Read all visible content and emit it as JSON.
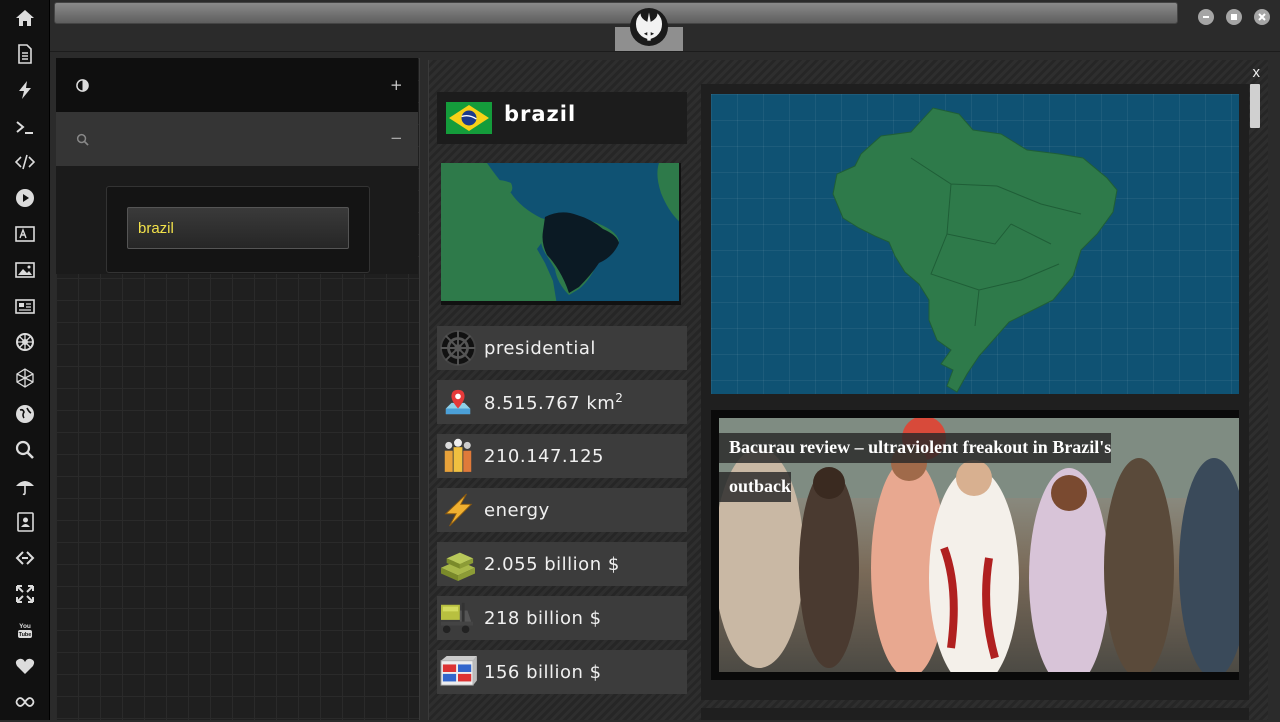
{
  "window": {
    "minimize_icon": "minus-icon",
    "maximize_icon": "square-icon",
    "close_icon": "x-icon"
  },
  "sidebar": {
    "icons": [
      "home-icon",
      "document-icon",
      "lightning-icon",
      "terminal-icon",
      "code-icon",
      "play-icon",
      "translate-icon",
      "image-icon",
      "news-icon",
      "empire-icon",
      "crystal-icon",
      "globe-icon",
      "search-icon",
      "umbrella-icon",
      "contacts-icon",
      "link-icon",
      "fullscreen-icon",
      "youtube-icon",
      "heart-icon",
      "infinity-icon"
    ]
  },
  "left_panel": {
    "theme_icon": "contrast-icon",
    "expand_symbol": "+",
    "search_icon": "search-icon",
    "collapse_symbol": "−",
    "search_value": "brazil"
  },
  "content": {
    "close_label": "x",
    "country": {
      "name": "brazil",
      "government": "presidential",
      "area_value": "8.515.767 km",
      "area_unit_sup": "2",
      "population": "210.147.125",
      "sector": "energy",
      "gdp": "2.055 billion $",
      "exports": "218 billion $",
      "imports": "156 billion $"
    },
    "news": {
      "headline": "Bacurau review – ultraviolent freakout in Brazil's outback"
    }
  },
  "colors": {
    "ocean": "#0f5273",
    "land": "#2e7a4a",
    "highlight_land": "#0b1a24",
    "accent_text": "#f2e24a"
  }
}
